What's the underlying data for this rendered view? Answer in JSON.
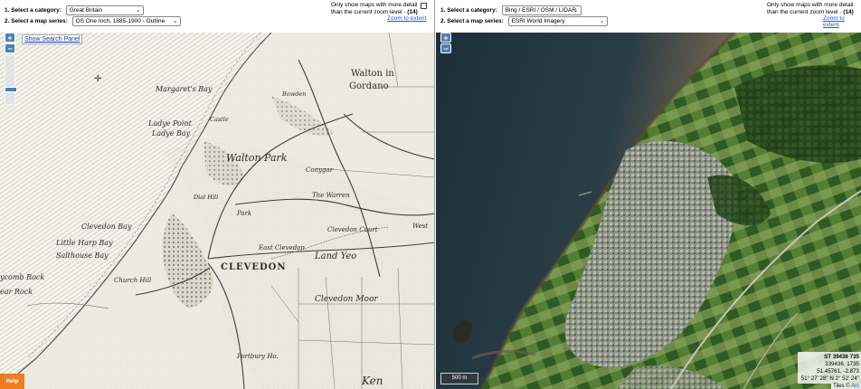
{
  "left": {
    "category_label": "1. Select a category:",
    "category_value": "Great Britain",
    "series_label": "2. Select a map series:",
    "series_value": "OS One Inch, 1885-1900 - Outline",
    "detail_line1": "Only show maps with more detail",
    "detail_line2": "than the current zoom level -",
    "detail_zoom": "(14)",
    "zoom_to_extent": "Zoom to extent",
    "zoom_in": "+",
    "zoom_out": "−",
    "show_search_panel": "Show Search Panel",
    "help": "Help",
    "map_labels": {
      "margarets_bay": "Margaret's Bay",
      "walton": "Walton in",
      "gordano": "Gordano",
      "ladye_point": "Ladye Point",
      "ladye_bay": "Ladye Bay",
      "castle": "Castle",
      "walton_park": "Walton Park",
      "conygar": "Conygar",
      "the_warren": "The Warren",
      "clevedon_bay": "Clevedon Bay",
      "little_harp_bay": "Little Harp Bay",
      "salthouse_bay": "Salthouse Bay",
      "clevedon": "CLEVEDON",
      "east_clevedon": "East Clevedon",
      "clevedon_court": "Clevedon Court",
      "land_yeo": "Land Yeo",
      "clevedon_moor": "Clevedon Moor",
      "church_hill": "Church Hill",
      "comb_rock": "ycomb Rock",
      "bear_rock": "ear Rock",
      "portbury": "Portbury Ho.",
      "ken": "Ken",
      "bowden": "Bowden",
      "dial_hill": "Dial Hill",
      "park": "Park",
      "west": "West"
    }
  },
  "right": {
    "category_label": "1. Select a category:",
    "category_value": "Bing / ESRI / OSM / LIDAR",
    "series_label": "2. Select a map series:",
    "series_value": "ESRI World Imagery",
    "detail_line1": "Only show maps with more detail",
    "detail_line2": "than the current zoom level -",
    "detail_zoom": "(14)",
    "zoom_to_extent": "Zoom to extent",
    "zoom_in": "+",
    "zoom_out": "−",
    "scale": "500 m",
    "coords": {
      "grid_ref": "ST 39436 735",
      "easting_northing": "339436, 1735",
      "lat_lon_dec": "51.45761, -2.873",
      "lat_lon_dms": "51° 27' 28\" N 2° 52' 24\""
    },
    "credit_prefix": "Tiles © ",
    "credit_link": "Arc"
  }
}
